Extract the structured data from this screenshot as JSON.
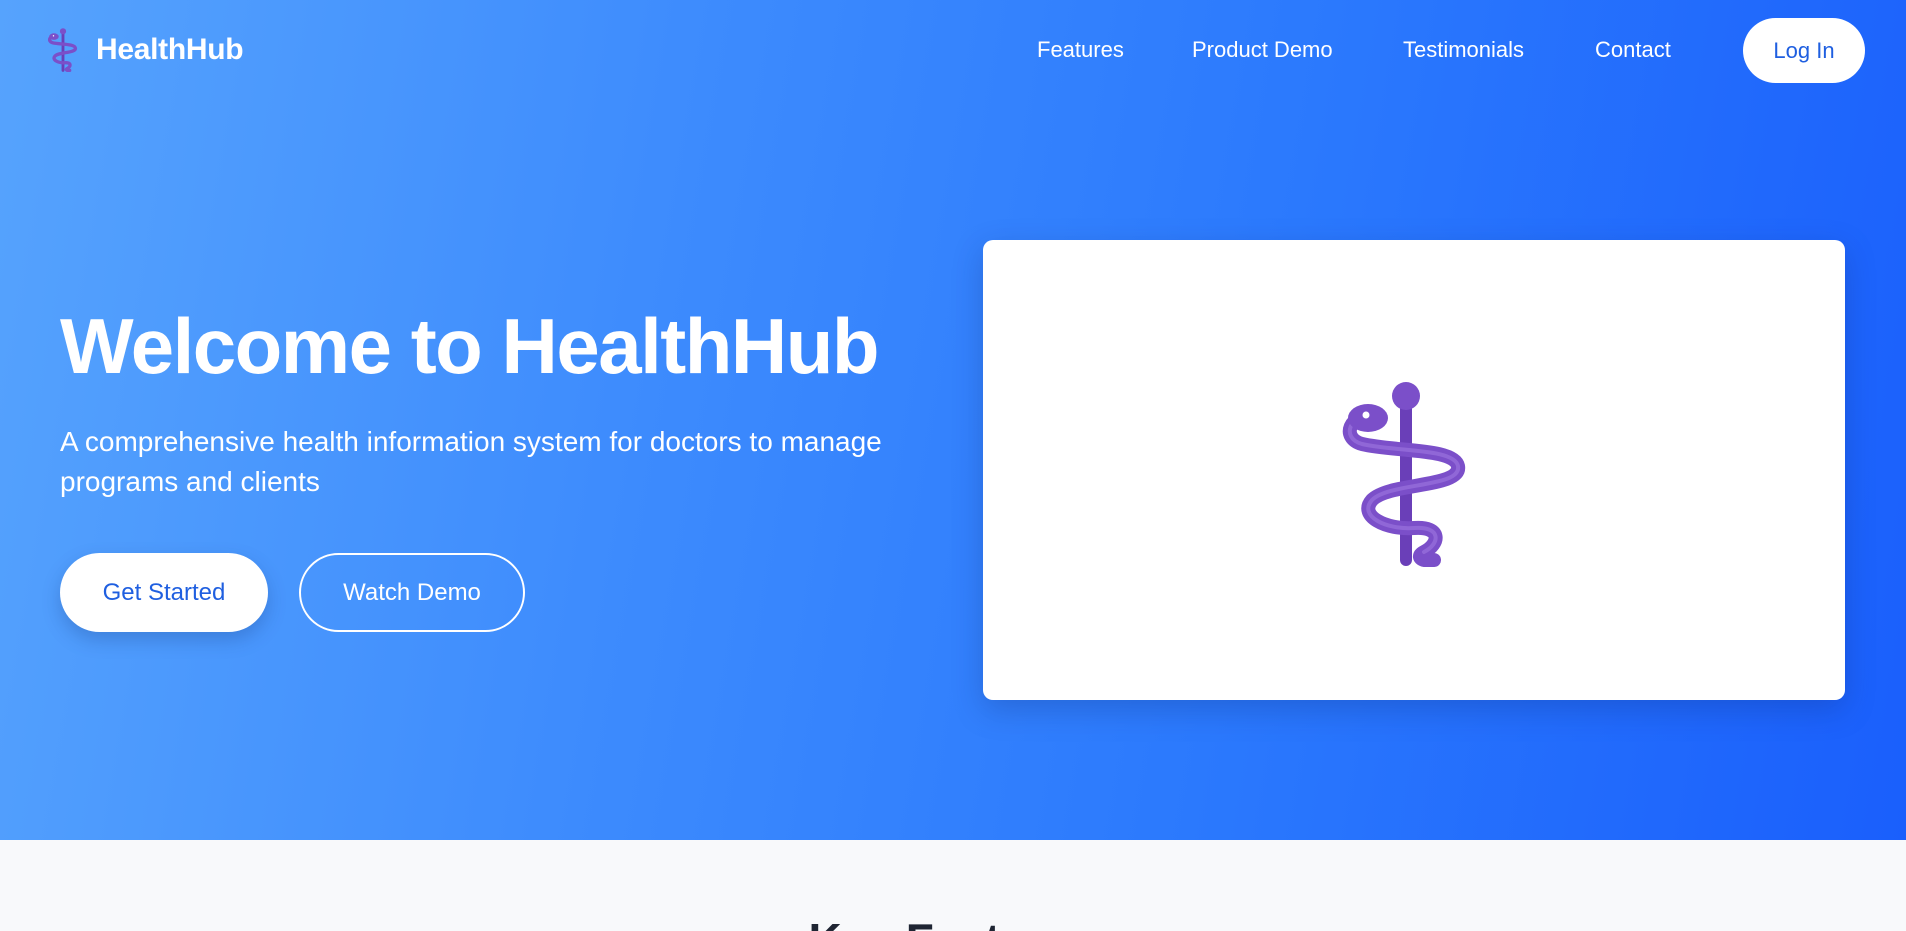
{
  "brand": {
    "name": "HealthHub",
    "icon": "staff-of-aesculapius-icon",
    "icon_color": "#7b4fc9"
  },
  "nav": {
    "links": [
      "Features",
      "Product Demo",
      "Testimonials",
      "Contact"
    ],
    "login_label": "Log In"
  },
  "hero": {
    "title": "Welcome to HealthHub",
    "subtitle": "A comprehensive health information system for doctors to manage programs and clients",
    "primary_cta": "Get Started",
    "secondary_cta": "Watch Demo"
  },
  "colors": {
    "gradient_start": "#56a3fd",
    "gradient_end": "#1a5ffc",
    "accent_text": "#1f5fe0",
    "section_bg": "#f8f9fb"
  },
  "next_section": {
    "heading": "Key Features"
  }
}
